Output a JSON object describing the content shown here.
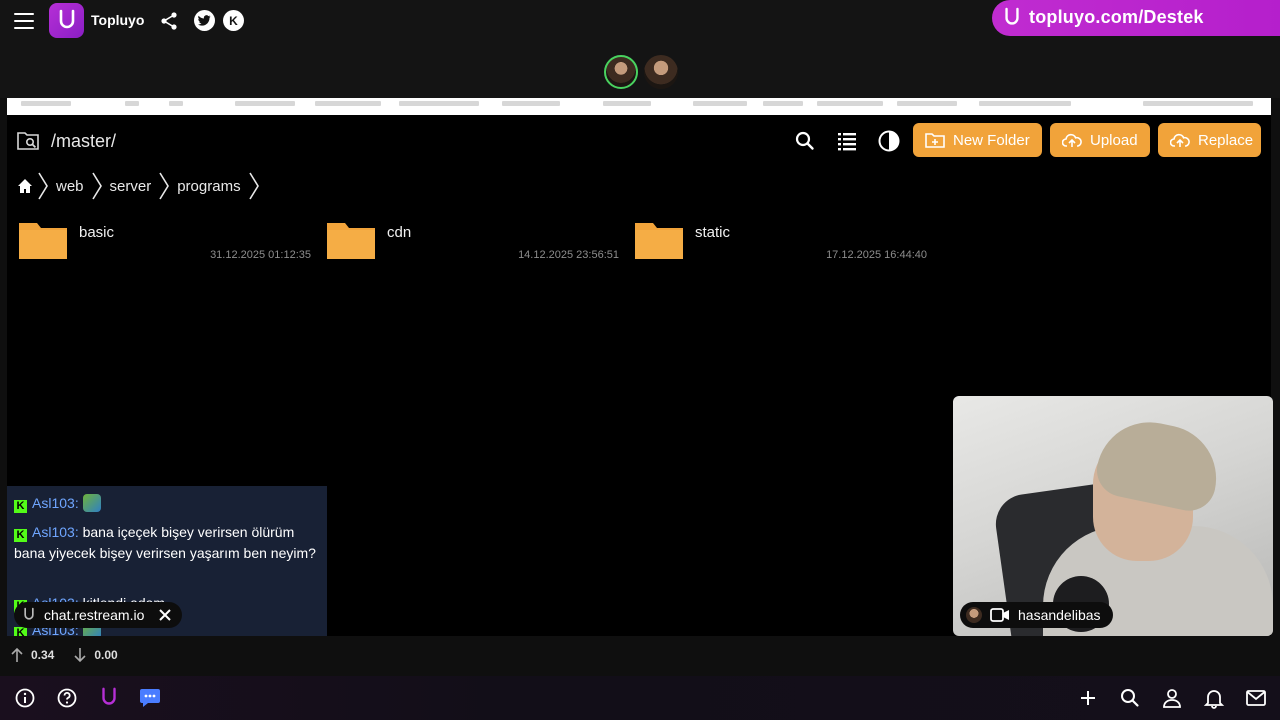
{
  "topbar": {
    "app_title": "Topluyo",
    "promo_text": "topluyo.com/Destek"
  },
  "file_manager": {
    "path": "/master/",
    "buttons": {
      "new_folder": "New Folder",
      "upload": "Upload",
      "replace": "Replace"
    },
    "breadcrumbs": [
      "web",
      "server",
      "programs"
    ],
    "folders": [
      {
        "name": "basic",
        "date": "31.12.2025 01:12:35"
      },
      {
        "name": "cdn",
        "date": "14.12.2025 23:56:51"
      },
      {
        "name": "static",
        "date": "17.12.2025 16:44:40"
      }
    ],
    "accent_color": "#f1a33a"
  },
  "chat": {
    "messages": [
      {
        "user": "Asl103",
        "text": ""
      },
      {
        "user": "Asl103",
        "text": "bana içeçek bişey verirsen ölürüm bana yiyecek bişey verirsen yaşarım ben neyim?"
      },
      {
        "user": "Asl103",
        "text": "kitlendi adam"
      },
      {
        "user": "Asl103",
        "text": ""
      }
    ],
    "source": "chat.restream.io"
  },
  "webcam": {
    "streamer": "hasandelibas"
  },
  "stats": {
    "upload": "0.34",
    "download": "0.00"
  }
}
